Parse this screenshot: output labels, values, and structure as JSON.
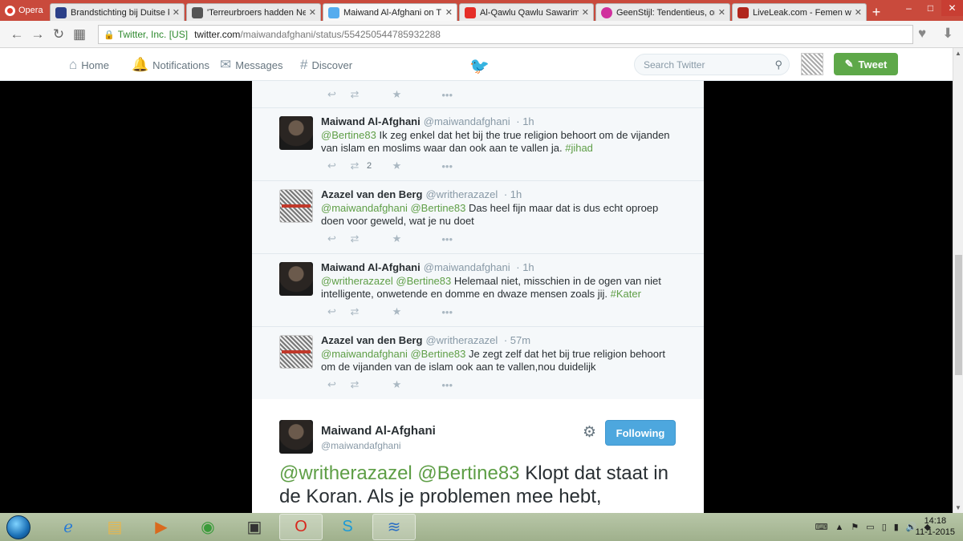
{
  "browser": {
    "menu_label": "Opera",
    "tabs": [
      {
        "title": "Brandstichting bij Duitse k",
        "favicon_color": "#2b3f88",
        "active": false
      },
      {
        "title": "'Terreurbroers hadden Ne",
        "favicon_color": "#555555",
        "active": false
      },
      {
        "title": "Maiwand Al-Afghani on T",
        "favicon_color": "#55acee",
        "active": true
      },
      {
        "title": "Al-Qawlu Qawlu Sawarim",
        "favicon_color": "#e52d27",
        "active": false
      },
      {
        "title": "GeenStijl: Tendentieus, on",
        "favicon_color": "#d0309d",
        "active": false
      },
      {
        "title": "LiveLeak.com - Femen wo",
        "favicon_color": "#b1261d",
        "active": false
      }
    ],
    "new_tab": "+",
    "window_controls": [
      "–",
      "□",
      "✕"
    ],
    "security_label": "Twitter, Inc. [US]",
    "url_domain": "twitter.com",
    "url_path": "/maiwandafghani/status/554250544785932288"
  },
  "twitter_nav": {
    "home": "Home",
    "notifications": "Notifications",
    "messages": "Messages",
    "discover": "Discover",
    "search_placeholder": "Search Twitter",
    "tweet_button": "Tweet"
  },
  "replies": [
    {
      "author": "Maiwand Al-Afghani",
      "handle": "@maiwandafghani",
      "time": "· 1h",
      "avatar": "maiwand",
      "mentions": "@Bertine83",
      "body": " Ik zeg enkel dat het bij the true religion behoort om de vijanden van islam en moslims waar dan ook aan te vallen ja. ",
      "hashtag": "#jihad",
      "retweets": "2"
    },
    {
      "author": "Azazel van den Berg",
      "handle": "@writherazazel",
      "time": "· 1h",
      "avatar": "azazel",
      "mentions": "@maiwandafghani @Bertine83",
      "body": " Das heel fijn maar dat is dus echt oproep doen voor geweld, wat je nu doet",
      "hashtag": "",
      "retweets": ""
    },
    {
      "author": "Maiwand Al-Afghani",
      "handle": "@maiwandafghani",
      "time": "· 1h",
      "avatar": "maiwand",
      "mentions": "@writherazazel @Bertine83",
      "body": " Helemaal niet, misschien in de ogen van niet intelligente, onwetende en domme en dwaze mensen zoals jij. ",
      "hashtag": "#Kater",
      "retweets": ""
    },
    {
      "author": "Azazel van den Berg",
      "handle": "@writherazazel",
      "time": "· 57m",
      "avatar": "azazel",
      "mentions": "@maiwandafghani @Bertine83",
      "body": " Je zegt zelf dat het bij true religion behoort om de vijanden van de islam ook aan te vallen,nou duidelijk",
      "hashtag": "",
      "retweets": ""
    }
  ],
  "main_tweet": {
    "author": "Maiwand Al-Afghani",
    "handle": "@maiwandafghani",
    "follow_label": "Following",
    "mentions": "@writherazazel @Bertine83",
    "body": " Klopt dat staat in de Koran. Als je problemen mee hebt,"
  },
  "taskbar": {
    "clock_time": "14:18",
    "clock_date": "11-1-2015"
  },
  "colors": {
    "opera_red": "#c94a3c",
    "link_green": "#5e9e46",
    "tweet_green": "#5ea849",
    "follow_blue": "#4da7de"
  }
}
